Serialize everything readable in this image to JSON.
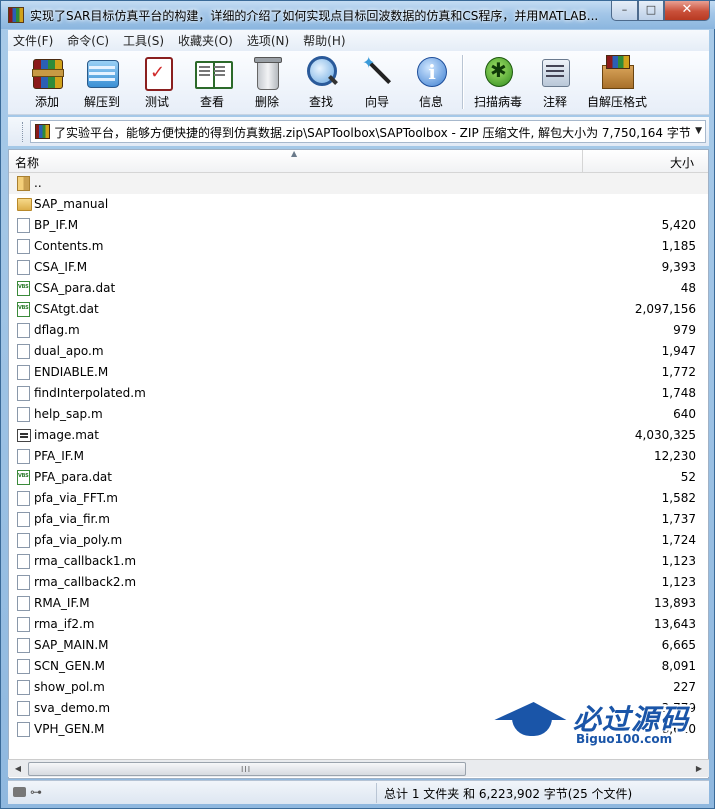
{
  "window": {
    "title": "实现了SAR目标仿真平台的构建，详细的介绍了如何实现点目标回波数据的仿真和CS程序，并用MATLAB...",
    "minimize": "–",
    "maximize": "□",
    "close": "✕"
  },
  "menu": [
    "文件(F)",
    "命令(C)",
    "工具(S)",
    "收藏夹(O)",
    "选项(N)",
    "帮助(H)"
  ],
  "toolbar": {
    "add": "添加",
    "extract": "解压到",
    "test": "测试",
    "view": "查看",
    "delete": "删除",
    "find": "查找",
    "wizard": "向导",
    "info": "信息",
    "virus": "扫描病毒",
    "comment": "注释",
    "sfx": "自解压格式"
  },
  "address": {
    "path": "了实验平台，能够方便快捷的得到仿真数据.zip\\SAPToolbox\\SAPToolbox - ZIP 压缩文件, 解包大小为 7,750,164 字节"
  },
  "columns": {
    "name": "名称",
    "size": "大小"
  },
  "files": [
    {
      "name": "..",
      "size": "",
      "type": "folder-up"
    },
    {
      "name": "SAP_manual",
      "size": "",
      "type": "folder"
    },
    {
      "name": "BP_IF.M",
      "size": "5,420",
      "type": "file"
    },
    {
      "name": "Contents.m",
      "size": "1,185",
      "type": "file"
    },
    {
      "name": "CSA_IF.M",
      "size": "9,393",
      "type": "file"
    },
    {
      "name": "CSA_para.dat",
      "size": "48",
      "type": "dat"
    },
    {
      "name": "CSAtgt.dat",
      "size": "2,097,156",
      "type": "dat"
    },
    {
      "name": "dflag.m",
      "size": "979",
      "type": "file"
    },
    {
      "name": "dual_apo.m",
      "size": "1,947",
      "type": "file"
    },
    {
      "name": "ENDIABLE.M",
      "size": "1,772",
      "type": "file"
    },
    {
      "name": "findInterpolated.m",
      "size": "1,748",
      "type": "file"
    },
    {
      "name": "help_sap.m",
      "size": "640",
      "type": "file"
    },
    {
      "name": "image.mat",
      "size": "4,030,325",
      "type": "mat"
    },
    {
      "name": "PFA_IF.M",
      "size": "12,230",
      "type": "file"
    },
    {
      "name": "PFA_para.dat",
      "size": "52",
      "type": "dat"
    },
    {
      "name": "pfa_via_FFT.m",
      "size": "1,582",
      "type": "file"
    },
    {
      "name": "pfa_via_fir.m",
      "size": "1,737",
      "type": "file"
    },
    {
      "name": "pfa_via_poly.m",
      "size": "1,724",
      "type": "file"
    },
    {
      "name": "rma_callback1.m",
      "size": "1,123",
      "type": "file"
    },
    {
      "name": "rma_callback2.m",
      "size": "1,123",
      "type": "file"
    },
    {
      "name": "RMA_IF.M",
      "size": "13,893",
      "type": "file"
    },
    {
      "name": "rma_if2.m",
      "size": "13,643",
      "type": "file"
    },
    {
      "name": "SAP_MAIN.M",
      "size": "6,665",
      "type": "file"
    },
    {
      "name": "SCN_GEN.M",
      "size": "8,091",
      "type": "file"
    },
    {
      "name": "show_pol.m",
      "size": "227",
      "type": "file"
    },
    {
      "name": "sva_demo.m",
      "size": "3,779",
      "type": "file"
    },
    {
      "name": "VPH_GEN.M",
      "size": "8,620",
      "type": "file"
    }
  ],
  "status": {
    "summary": "总计 1 文件夹 和 6,223,902 字节(25 个文件)",
    "key_icon": "⊶"
  },
  "watermark": {
    "title": "必过源码",
    "url": "Biguo100.com"
  },
  "scrollbar": {
    "left": "◀",
    "right": "▶",
    "grip": "III"
  }
}
